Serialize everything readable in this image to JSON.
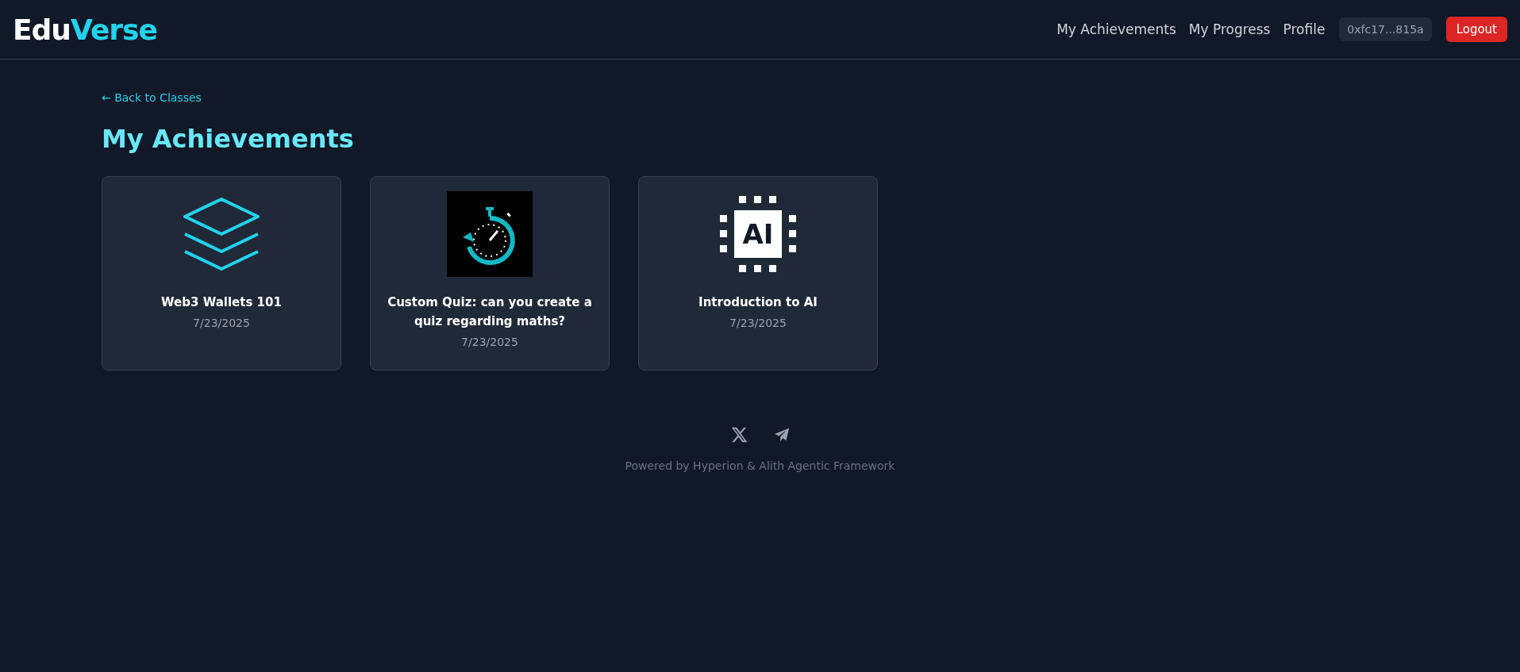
{
  "header": {
    "logo": [
      {
        "text": "Edu",
        "color": "#ffffff"
      },
      {
        "text": "Verse",
        "color": "#22d3ee"
      }
    ],
    "nav": [
      {
        "label": "My Achievements"
      },
      {
        "label": "My Progress"
      },
      {
        "label": "Profile"
      }
    ],
    "wallet": "0xfc17...815a",
    "logout": "Logout"
  },
  "back_link": "← Back to Classes",
  "title": "My Achievements",
  "achievements": [
    {
      "kind": "layers",
      "title": "Web3 Wallets 101",
      "date": "7/23/2025"
    },
    {
      "kind": "stopwatch",
      "title": "Custom Quiz: can you create a quiz regarding maths?",
      "date": "7/23/2025"
    },
    {
      "kind": "chip",
      "icon_text": "AI",
      "title": "Introduction to AI",
      "date": "7/23/2025"
    }
  ],
  "footer": {
    "socials": [
      {
        "kind": "x"
      },
      {
        "kind": "telegram"
      }
    ],
    "text": "Powered by Hyperion & Alith Agentic Framework"
  }
}
